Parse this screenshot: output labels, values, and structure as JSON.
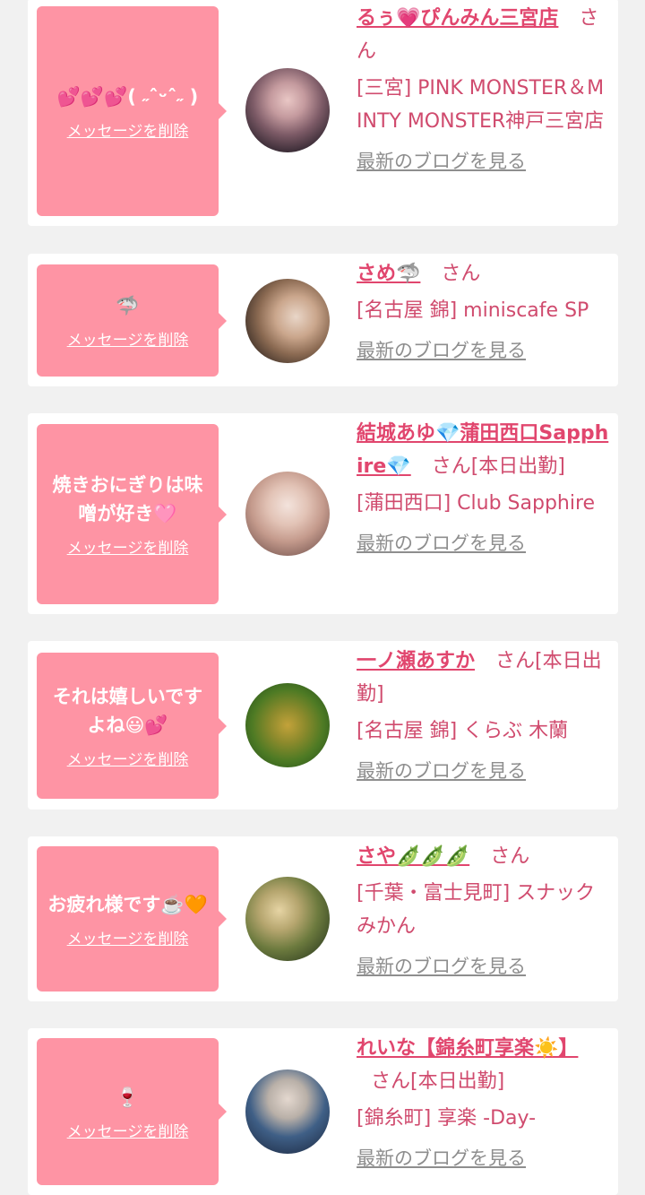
{
  "delete_label": "メッセージを削除",
  "blog_label": "最新のブログを見る",
  "colors": {
    "background": "#f1f1f1",
    "bubble": "#fe94a4",
    "name": "#e1466e",
    "shop": "#d04b6e",
    "blog_link": "#8e8e8e"
  },
  "cards": [
    {
      "message": "💕💕💕( ˶ˆᵕˆ˶ )",
      "name": "るぅ💗ぴんみん三宮店",
      "san": "さん",
      "shop": "[三宮] PINK MONSTER＆MINTY MONSTER神戸三宮店",
      "avatar_icon": "girl-with-glasses-photo"
    },
    {
      "message": "🦈",
      "name": "さめ🦈",
      "san": "さん",
      "shop": "[名古屋 錦] miniscafe SP",
      "avatar_icon": "girl-with-sticker-photo"
    },
    {
      "message": "焼きおにぎりは味噌が好き🩷",
      "name": "結城あゆ💎蒲田西口Sapphire💎",
      "san": "さん[本日出勤]",
      "shop": "[蒲田西口] Club Sapphire",
      "avatar_icon": "girl-with-flower-hair-photo"
    },
    {
      "message": "それは嬉しいですよね😃💕",
      "name": "一ノ瀬あすか",
      "san": "さん[本日出勤]",
      "shop": "[名古屋 錦] くらぶ 木蘭",
      "avatar_icon": "calligraphy-logo-photo"
    },
    {
      "message": "お疲れ様です☕️🧡",
      "name": "さや🫛🫛🫛",
      "san": "さん",
      "shop": "[千葉・富士見町] スナックみかん",
      "avatar_icon": "woman-in-garden-photo"
    },
    {
      "message": "🍷",
      "name": "れいな【錦糸町享楽☀️】",
      "san": "さん[本日出勤]",
      "shop": "[錦糸町] 享楽 -Day-",
      "avatar_icon": "woman-in-lace-dress-photo"
    }
  ]
}
